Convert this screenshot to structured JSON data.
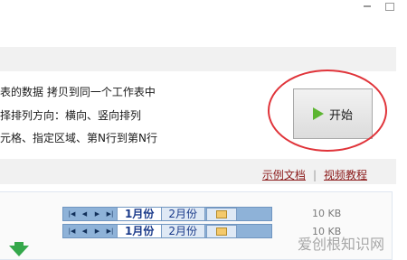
{
  "features": {
    "line1": "表的数据 拷贝到同一个工作表中",
    "line2": "择排列方向：横向、竖向排列",
    "line3": "元格、指定区域、第N行到第N行"
  },
  "start_button": {
    "label": "开始",
    "icon": "play-icon"
  },
  "links": {
    "example_doc": "示例文档",
    "separator": "|",
    "video_tutorial": "视频教程"
  },
  "sheet_tabs": [
    {
      "tabs": [
        "1月份",
        "2月份"
      ],
      "active": "1月份",
      "size": "10 KB"
    },
    {
      "tabs": [
        "1月份",
        "2月份"
      ],
      "active": "1月份",
      "size": "10 KB"
    }
  ],
  "watermark": "爱创根知识网",
  "colors": {
    "accent_circle": "#e0343a",
    "play_icon": "#5cb531",
    "link": "#8b1a1a"
  }
}
